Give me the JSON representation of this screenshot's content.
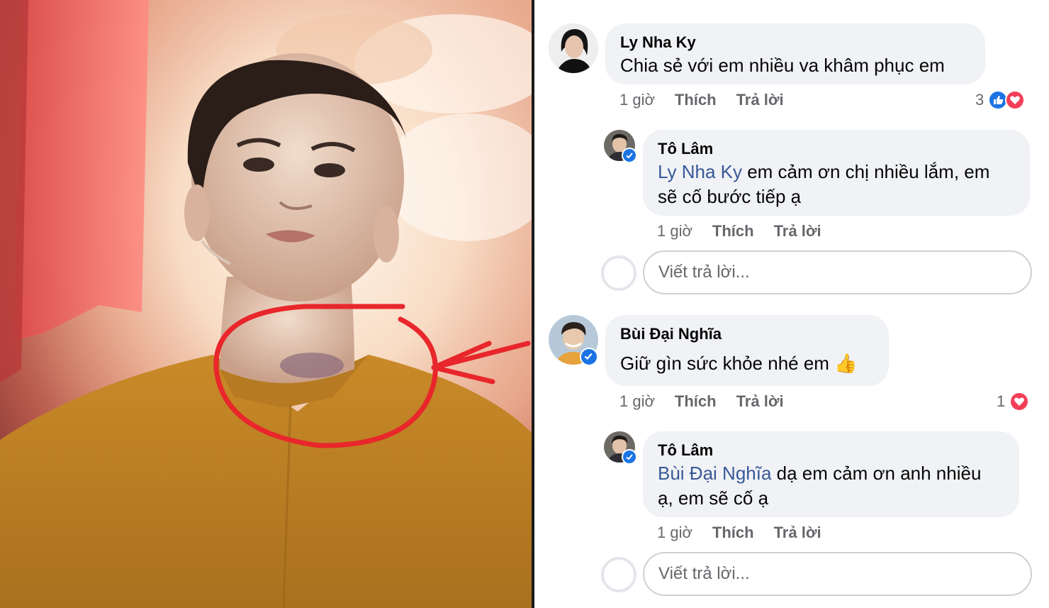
{
  "photo": {
    "description_icon": "stage-performer-photo",
    "annotation_color": "#e8262b"
  },
  "comments": [
    {
      "author": "Ly Nha Ky",
      "text": "Chia sẻ với em nhiều va khâm phục em",
      "time": "1 giờ",
      "like_label": "Thích",
      "reply_label": "Trả lời",
      "reaction_count": "3",
      "reactions": [
        "like-icon",
        "love-icon"
      ],
      "replies": [
        {
          "author": "Tô Lâm",
          "mention": "Ly Nha Ky",
          "text_line1": " em cảm ơn chị nhiều lắm, em",
          "text_line2": "sẽ cố bước tiếp ạ",
          "time": "1 giờ",
          "like_label": "Thích",
          "reply_label": "Trả lời"
        }
      ],
      "reply_placeholder": "Viết trả lời..."
    },
    {
      "author": "Bùi Đại Nghĩa",
      "text": "Giữ gìn sức khỏe nhé em",
      "emoji": "👍",
      "time": "1 giờ",
      "like_label": "Thích",
      "reply_label": "Trả lời",
      "reaction_count": "1",
      "reactions": [
        "love-icon"
      ],
      "replies": [
        {
          "author": "Tô Lâm",
          "mention": "Bùi Đại Nghĩa",
          "text_line1": " dạ em cảm ơn anh nhiều",
          "text_line2": "ạ, em sẽ cố ạ",
          "time": "1 giờ",
          "like_label": "Thích",
          "reply_label": "Trả lời"
        }
      ],
      "reply_placeholder": "Viết trả lời..."
    }
  ],
  "colors": {
    "mention": "#385898",
    "bubble": "#f0f2f5",
    "meta": "#65676b",
    "like": "#1b74e4",
    "love": "#f33e58"
  }
}
